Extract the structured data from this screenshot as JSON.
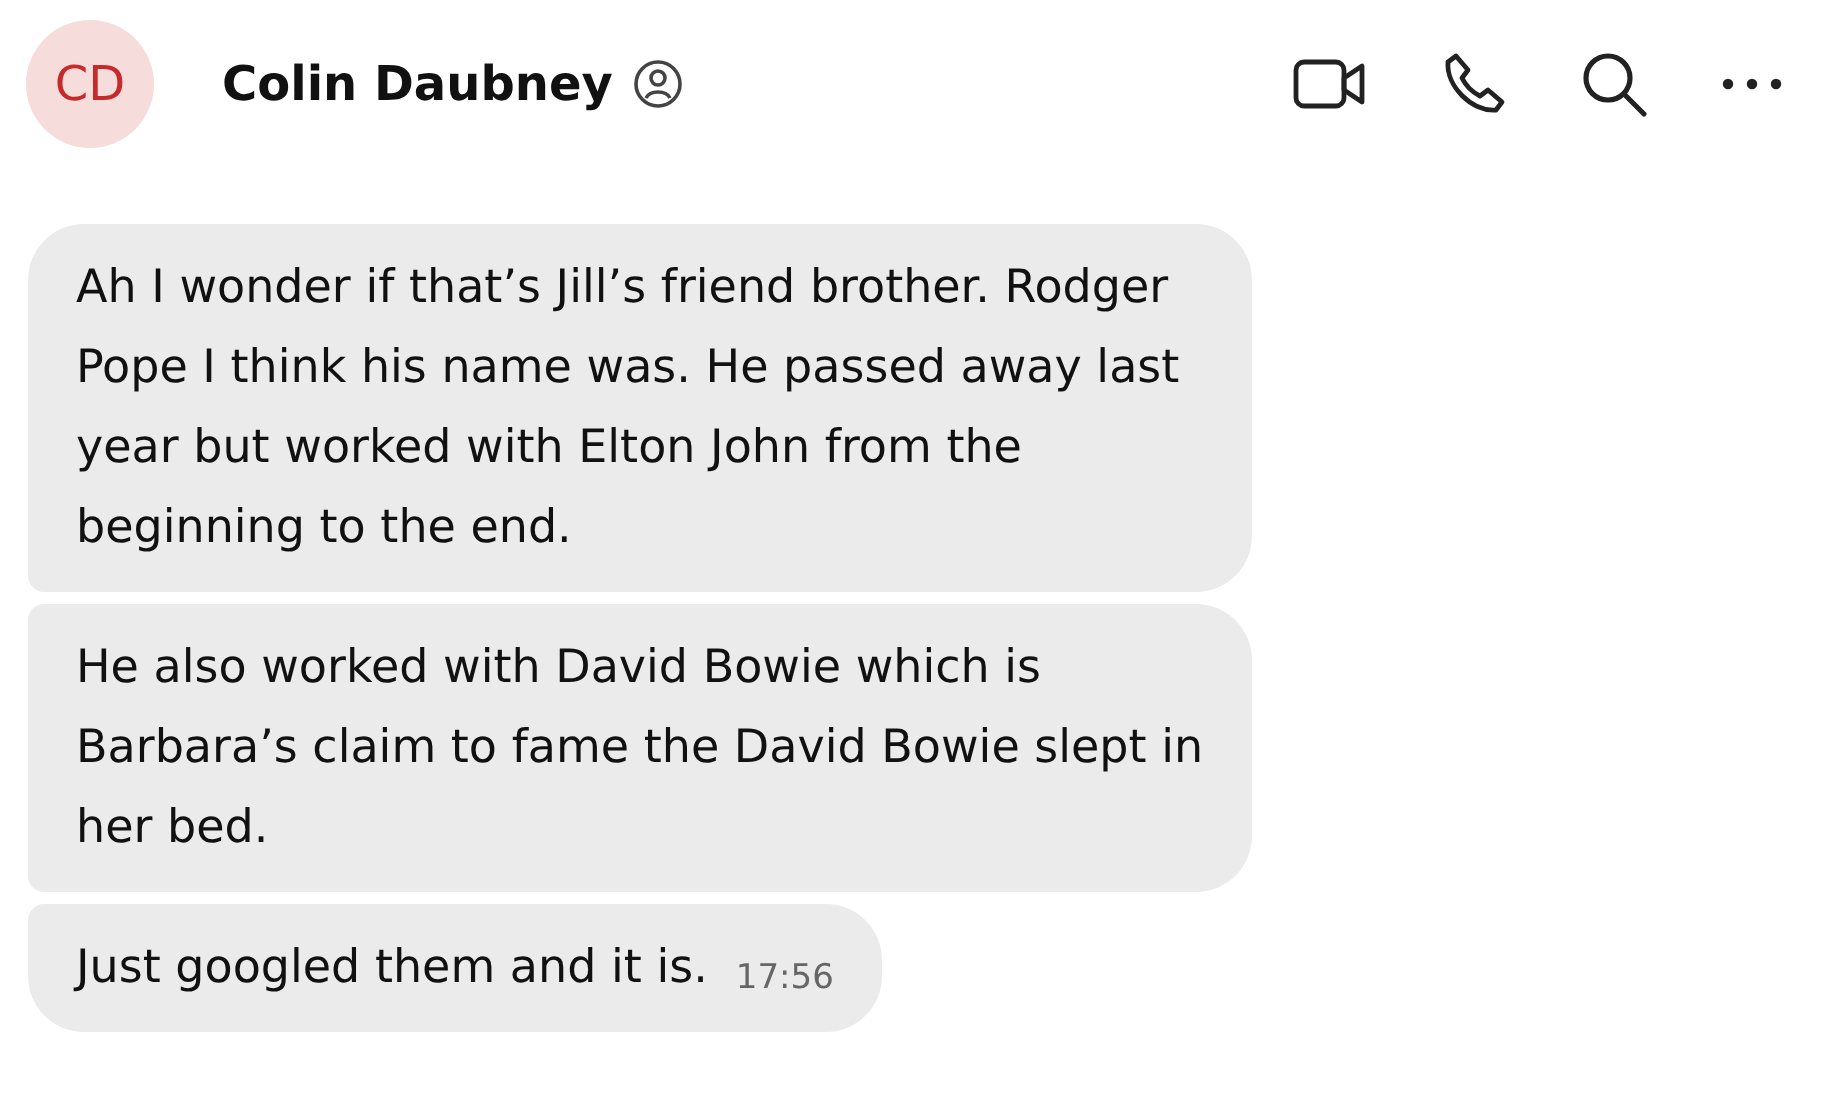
{
  "header": {
    "avatar_initials": "CD",
    "name": "Colin Daubney",
    "actions": [
      {
        "kind": "video"
      },
      {
        "kind": "phone"
      },
      {
        "kind": "search"
      },
      {
        "kind": "more"
      }
    ]
  },
  "messages": [
    {
      "text": "Ah I wonder if that’s Jill’s friend brother. Rodger Pope I think his name was. He passed away last year but worked with Elton John from the beginning to the end."
    },
    {
      "text": "He also worked with David Bowie which is Barbara’s claim to fame the David Bowie slept in her bed."
    },
    {
      "text": "Just googled them and it is.",
      "time": "17:56"
    }
  ]
}
